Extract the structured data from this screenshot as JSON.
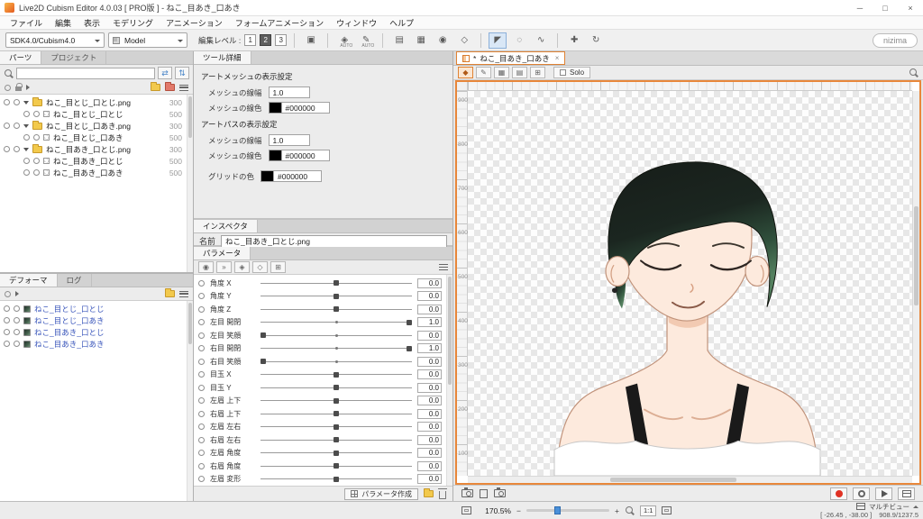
{
  "titlebar": {
    "title": "Live2D Cubism Editor 4.0.03   [ PRO版 ] - ねこ_目あき_口あき",
    "minimize": "─",
    "maximize": "□",
    "close": "×"
  },
  "menubar": {
    "items": [
      {
        "label": "ファイル"
      },
      {
        "label": "編集"
      },
      {
        "label": "表示"
      },
      {
        "label": "モデリング"
      },
      {
        "label": "アニメーション"
      },
      {
        "label": "フォームアニメーション"
      },
      {
        "label": "ウィンドウ"
      },
      {
        "label": "ヘルプ"
      }
    ]
  },
  "toolbar": {
    "sdk_select": "SDK4.0/Cubism4.0",
    "mode_select": "Model",
    "edit_level_label": "編集レベル :",
    "edit_levels": [
      {
        "label": "1"
      },
      {
        "label": "2",
        "active": true
      },
      {
        "label": "3"
      }
    ],
    "tools_a": [
      {
        "glyph": "▣",
        "name": "model-guide-icon"
      }
    ],
    "tools_b": [
      {
        "glyph": "◈",
        "sub": "AUTO",
        "name": "magnet-auto-icon"
      },
      {
        "glyph": "✎",
        "sub": "AUTO",
        "name": "pen-auto-icon"
      }
    ],
    "tools_c": [
      {
        "glyph": "▤",
        "name": "mesh-edit-icon"
      },
      {
        "glyph": "▦",
        "name": "art-mesh-icon"
      },
      {
        "glyph": "◉",
        "name": "glue-icon"
      },
      {
        "glyph": "◇",
        "name": "art-path-icon"
      }
    ],
    "tools_d": [
      {
        "glyph": "◤",
        "name": "arrow-tool-icon",
        "active": true
      },
      {
        "glyph": "◌",
        "name": "lasso-tool-icon"
      },
      {
        "glyph": "∿",
        "name": "brush-tool-icon"
      }
    ],
    "tools_e": [
      {
        "glyph": "✚",
        "name": "pan-tool-icon"
      },
      {
        "glyph": "↻",
        "name": "rotate-tool-icon"
      }
    ],
    "nizima_label": "nizima"
  },
  "parts_panel": {
    "tab_parts": "パーツ",
    "tab_project": "プロジェクト",
    "search_swap_icon": "⇄",
    "search_sort_icon": "⇅",
    "rows": [
      {
        "label": "ねこ_目とじ_口とじ.png",
        "value": "300",
        "kind": "folder"
      },
      {
        "label": "ねこ_目とじ_口とじ",
        "value": "500",
        "kind": "mesh"
      },
      {
        "label": "ねこ_目とじ_口あき.png",
        "value": "300",
        "kind": "folder"
      },
      {
        "label": "ねこ_目とじ_口あき",
        "value": "500",
        "kind": "mesh"
      },
      {
        "label": "ねこ_目あき_口とじ.png",
        "value": "300",
        "kind": "folder"
      },
      {
        "label": "ねこ_目あき_口とじ",
        "value": "500",
        "kind": "mesh"
      },
      {
        "label": "ねこ_目あき_口あき",
        "value": "500",
        "kind": "mesh"
      }
    ]
  },
  "deformer_panel": {
    "tab_deformer": "デフォーマ",
    "tab_log": "ログ",
    "rows": [
      {
        "label": "ねこ_目とじ_口とじ"
      },
      {
        "label": "ねこ_目とじ_口あき"
      },
      {
        "label": "ねこ_目あき_口とじ"
      },
      {
        "label": "ねこ_目あき_口あき"
      }
    ]
  },
  "tool_detail": {
    "tab": "ツール詳細",
    "sections": [
      {
        "title": "アートメッシュの表示設定",
        "fields": [
          {
            "label": "メッシュの線幅",
            "value": "1.0"
          },
          {
            "label": "メッシュの線色",
            "value": "#000000"
          }
        ]
      },
      {
        "title": "アートパスの表示設定",
        "fields": [
          {
            "label": "メッシュの線幅",
            "value": "1.0"
          },
          {
            "label": "メッシュの線色",
            "value": "#000000"
          }
        ]
      }
    ],
    "grid_color_label": "グリッドの色",
    "grid_color_value": "#000000"
  },
  "inspector": {
    "tab": "インスペクタ",
    "name_label": "名前",
    "name_value": "ねこ_目あき_口とじ.png"
  },
  "parameters": {
    "tab": "パラメータ",
    "toolbar_icons": [
      {
        "glyph": "◉",
        "name": "key-link-icon"
      },
      {
        "glyph": "»",
        "name": "expand-all-icon"
      },
      {
        "glyph": "◈",
        "name": "magnet-on-icon"
      },
      {
        "glyph": "◇",
        "name": "magnet-off-icon"
      },
      {
        "glyph": "⊞",
        "name": "grid-snap-icon"
      }
    ],
    "rows": [
      {
        "label": "角度 X",
        "value": "0.0",
        "knob": 0.5
      },
      {
        "label": "角度 Y",
        "value": "0.0",
        "knob": 0.5
      },
      {
        "label": "角度 Z",
        "value": "0.0",
        "knob": 0.5
      },
      {
        "label": "左目 開閉",
        "value": "1.0",
        "knob": 1.0
      },
      {
        "label": "左目 笑顔",
        "value": "0.0",
        "knob": 0.0
      },
      {
        "label": "右目 開閉",
        "value": "1.0",
        "knob": 1.0
      },
      {
        "label": "右目 笑顔",
        "value": "0.0",
        "knob": 0.0
      },
      {
        "label": "目玉 X",
        "value": "0.0",
        "knob": 0.5
      },
      {
        "label": "目玉 Y",
        "value": "0.0",
        "knob": 0.5
      },
      {
        "label": "左眉 上下",
        "value": "0.0",
        "knob": 0.5
      },
      {
        "label": "右眉 上下",
        "value": "0.0",
        "knob": 0.5
      },
      {
        "label": "左眉 左右",
        "value": "0.0",
        "knob": 0.5
      },
      {
        "label": "右眉 左右",
        "value": "0.0",
        "knob": 0.5
      },
      {
        "label": "左眉 角度",
        "value": "0.0",
        "knob": 0.5
      },
      {
        "label": "右眉 角度",
        "value": "0.0",
        "knob": 0.5
      },
      {
        "label": "左眉 変形",
        "value": "0.0",
        "knob": 0.5
      }
    ],
    "create_button": "パラメータ作成"
  },
  "canvas": {
    "tab_modified": "*",
    "tab_label": "ねこ_目あき_口あき",
    "tab_close": "×",
    "tools": [
      {
        "glyph": "◆",
        "name": "transform-tool-icon",
        "active": true
      },
      {
        "glyph": "✎",
        "name": "draw-tool-icon"
      },
      {
        "glyph": "▦",
        "name": "mesh-view-icon"
      },
      {
        "glyph": "▤",
        "name": "texture-view-icon"
      },
      {
        "glyph": "⊞",
        "name": "grid-view-icon"
      }
    ],
    "solo_label": "Solo",
    "ruler_labels": [
      {
        "label": "900"
      },
      {
        "label": "800"
      },
      {
        "label": "700"
      },
      {
        "label": "600"
      },
      {
        "label": "500"
      },
      {
        "label": "400"
      },
      {
        "label": "300"
      },
      {
        "label": "200"
      },
      {
        "label": "100"
      }
    ]
  },
  "statusbar": {
    "zoom": "170.5%",
    "minus": "−",
    "plus": "+",
    "one_to_one": "1:1",
    "multiview_label": "マルチビュー",
    "coords": "[ -26.45 , -38.00 ]",
    "size_info": "908.9/1237.5"
  }
}
